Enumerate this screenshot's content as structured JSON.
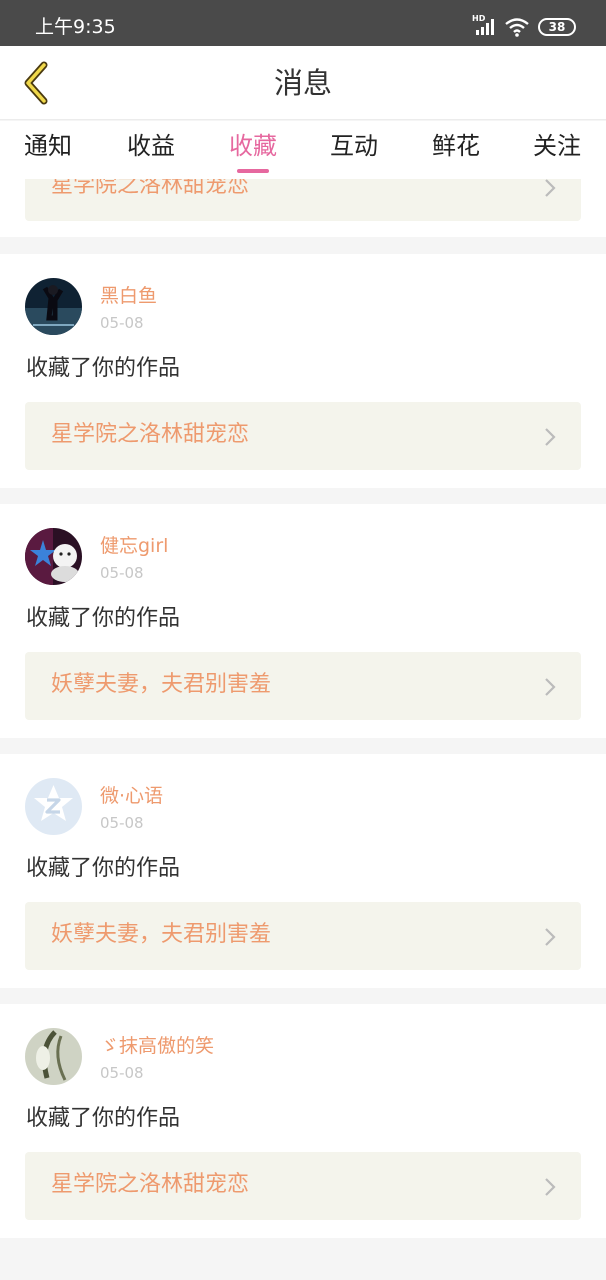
{
  "status_bar": {
    "time": "上午9:35",
    "battery": "38",
    "hd_label": "HD"
  },
  "header": {
    "title": "消息",
    "back_icon": "chevron-left-icon"
  },
  "tabs": [
    {
      "label": "通知",
      "active": false
    },
    {
      "label": "收益",
      "active": false
    },
    {
      "label": "收藏",
      "active": true
    },
    {
      "label": "互动",
      "active": false
    },
    {
      "label": "鲜花",
      "active": false
    },
    {
      "label": "关注",
      "active": false
    }
  ],
  "partial_item": {
    "work_title": "星学院之洛林甜宠恋"
  },
  "items": [
    {
      "username": "黑白鱼",
      "date": "05-08",
      "action": "收藏了你的作品",
      "work_title": "星学院之洛林甜宠恋"
    },
    {
      "username": "健忘girl",
      "date": "05-08",
      "action": "收藏了你的作品",
      "work_title": "妖孽夫妻，夫君别害羞"
    },
    {
      "username": "微·心语",
      "date": "05-08",
      "action": "收藏了你的作品",
      "work_title": "妖孽夫妻，夫君别害羞"
    },
    {
      "username": "ゞ抹高傲的笑",
      "date": "05-08",
      "action": "收藏了你的作品",
      "work_title": "星学院之洛林甜宠恋"
    }
  ],
  "colors": {
    "accent": "#e6689f",
    "link": "#ee9a6e",
    "status_bar": "#4a4a4a",
    "card_link_bg": "#f4f4ec"
  }
}
